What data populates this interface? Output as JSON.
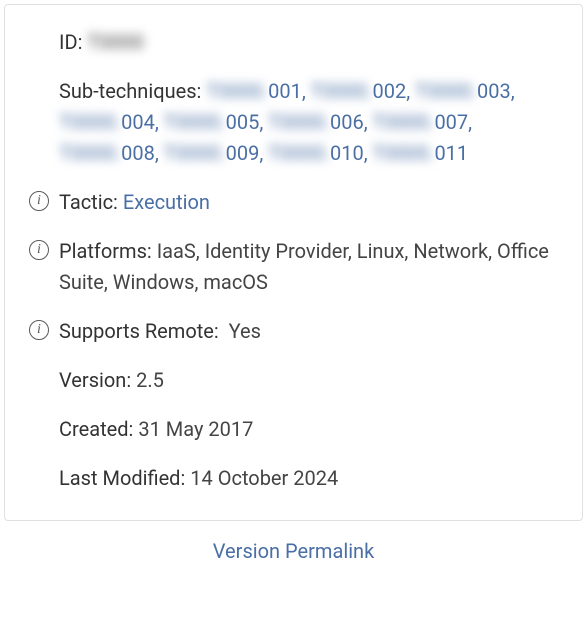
{
  "id": {
    "label": "ID:",
    "value": "T0000"
  },
  "sub": {
    "label": "Sub-techniques:",
    "items": [
      {
        "prefix": "T0000.",
        "num": "001"
      },
      {
        "prefix": "T0000.",
        "num": "002"
      },
      {
        "prefix": "T0000.",
        "num": "003"
      },
      {
        "prefix": "T0000.",
        "num": "004"
      },
      {
        "prefix": "T0000.",
        "num": "005"
      },
      {
        "prefix": "T0000.",
        "num": "006"
      },
      {
        "prefix": "T0000.",
        "num": "007"
      },
      {
        "prefix": "T0000.",
        "num": "008"
      },
      {
        "prefix": "T0000.",
        "num": "009"
      },
      {
        "prefix": "T0000.",
        "num": "010"
      },
      {
        "prefix": "T0000.",
        "num": "011"
      }
    ]
  },
  "tactic": {
    "label": "Tactic:",
    "value": "Execution"
  },
  "platforms": {
    "label": "Platforms:",
    "value": "IaaS, Identity Provider, Linux, Network, Office Suite, Windows, macOS"
  },
  "remote": {
    "label": "Supports Remote:",
    "value": "Yes"
  },
  "version": {
    "label": "Version:",
    "value": "2.5"
  },
  "created": {
    "label": "Created:",
    "value": "31 May 2017"
  },
  "modified": {
    "label": "Last Modified:",
    "value": "14 October 2024"
  },
  "permalink": {
    "label": "Version Permalink"
  }
}
